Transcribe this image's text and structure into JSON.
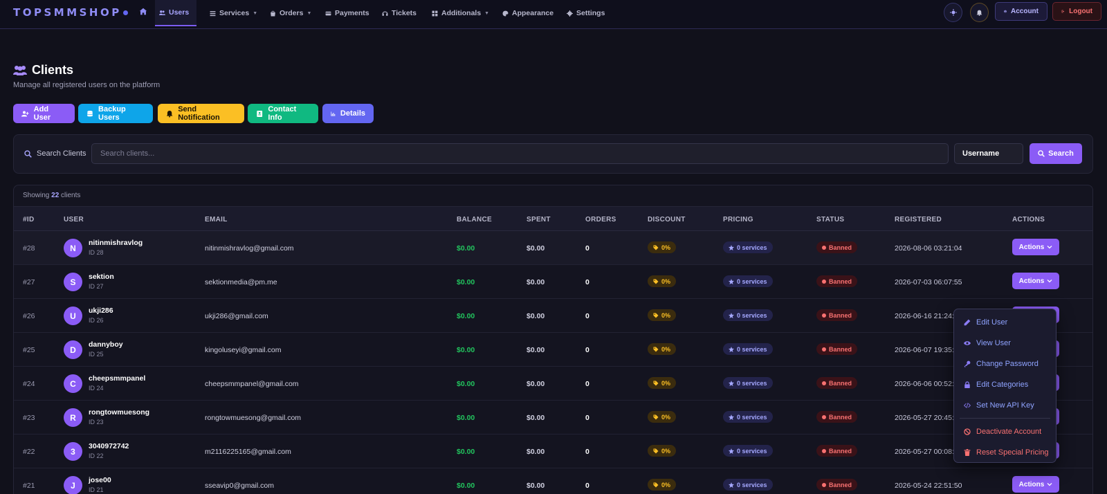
{
  "app": {
    "brand": "TOPSMMSHOP",
    "colors": {
      "accent": "#8b5cf6",
      "success": "#22c55e",
      "danger": "#f87171",
      "warning": "#fbbf24"
    }
  },
  "nav": {
    "items": [
      {
        "label": "Users",
        "icon": "users-icon",
        "active": true
      },
      {
        "label": "Services",
        "icon": "list-icon",
        "has_caret": true
      },
      {
        "label": "Orders",
        "icon": "bag-icon",
        "has_caret": true
      },
      {
        "label": "Payments",
        "icon": "card-icon"
      },
      {
        "label": "Tickets",
        "icon": "headset-icon"
      },
      {
        "label": "Additionals",
        "icon": "grid-icon",
        "has_caret": true
      },
      {
        "label": "Appearance",
        "icon": "palette-icon"
      },
      {
        "label": "Settings",
        "icon": "gear-icon"
      }
    ],
    "account_label": "Account",
    "logout_label": "Logout"
  },
  "page": {
    "title": "Clients",
    "subtitle": "Manage all registered users on the platform",
    "actions": [
      "Add User",
      "Backup Users",
      "Send Notification",
      "Contact Info",
      "Details"
    ]
  },
  "search": {
    "label": "Search Clients",
    "placeholder": "Search clients...",
    "value": "",
    "filter": "Username",
    "button": "Search"
  },
  "table": {
    "showing_prefix": "Showing",
    "showing_count": "22",
    "showing_suffix": "clients",
    "headers": [
      "#ID",
      "USER",
      "EMAIL",
      "BALANCE",
      "SPENT",
      "ORDERS",
      "DISCOUNT",
      "PRICING",
      "STATUS",
      "REGISTERED",
      "ACTIONS"
    ],
    "rows": [
      {
        "id": "#28",
        "initial": "N",
        "username": "nitinmishravlog",
        "uid": "ID 28",
        "email": "nitinmishravlog@gmail.com",
        "balance": "$0.00",
        "spent": "$0.00",
        "orders": "0",
        "discount": "0%",
        "pricing": "0 services",
        "status": "Banned",
        "registered": "2026-08-06 03:21:04",
        "action": "Actions"
      },
      {
        "id": "#27",
        "initial": "S",
        "username": "sektion",
        "uid": "ID 27",
        "email": "sektionmedia@pm.me",
        "balance": "$0.00",
        "spent": "$0.00",
        "orders": "0",
        "discount": "0%",
        "pricing": "0 services",
        "status": "Banned",
        "registered": "2026-07-03 06:07:55",
        "action": "Actions"
      },
      {
        "id": "#26",
        "initial": "U",
        "username": "ukji286",
        "uid": "ID 26",
        "email": "ukji286@gmail.com",
        "balance": "$0.00",
        "spent": "$0.00",
        "orders": "0",
        "discount": "0%",
        "pricing": "0 services",
        "status": "Banned",
        "registered": "2026-06-16 21:24:0",
        "action": ""
      },
      {
        "id": "#25",
        "initial": "D",
        "username": "dannyboy",
        "uid": "ID 25",
        "email": "kingoluseyi@gmail.com",
        "balance": "$0.00",
        "spent": "$0.00",
        "orders": "0",
        "discount": "0%",
        "pricing": "0 services",
        "status": "Banned",
        "registered": "2026-06-07 19:35:4",
        "action": ""
      },
      {
        "id": "#24",
        "initial": "C",
        "username": "cheepsmmpanel",
        "uid": "ID 24",
        "email": "cheepsmmpanel@gmail.com",
        "balance": "$0.00",
        "spent": "$0.00",
        "orders": "0",
        "discount": "0%",
        "pricing": "0 services",
        "status": "Banned",
        "registered": "2026-06-06 00:52:",
        "action": ""
      },
      {
        "id": "#23",
        "initial": "R",
        "username": "rongtowmuesong",
        "uid": "ID 23",
        "email": "rongtowmuesong@gmail.com",
        "balance": "$0.00",
        "spent": "$0.00",
        "orders": "0",
        "discount": "0%",
        "pricing": "0 services",
        "status": "Banned",
        "registered": "2026-05-27 20:45:",
        "action": ""
      },
      {
        "id": "#22",
        "initial": "3",
        "username": "3040972742",
        "uid": "ID 22",
        "email": "m2116225165@gmail.com",
        "balance": "$0.00",
        "spent": "$0.00",
        "orders": "0",
        "discount": "0%",
        "pricing": "0 services",
        "status": "Banned",
        "registered": "2026-05-27 00:08:",
        "action": ""
      },
      {
        "id": "#21",
        "initial": "J",
        "username": "jose00",
        "uid": "ID 21",
        "email": "sseavip0@gmail.com",
        "balance": "$0.00",
        "spent": "$0.00",
        "orders": "0",
        "discount": "0%",
        "pricing": "0 services",
        "status": "Banned",
        "registered": "2026-05-24 22:51:50",
        "action": "Actions"
      }
    ]
  },
  "dropdown": {
    "items": [
      {
        "label": "Edit User",
        "icon": "pencil-icon"
      },
      {
        "label": "View User",
        "icon": "eye-icon"
      },
      {
        "label": "Change Password",
        "icon": "key-icon"
      },
      {
        "label": "Edit Categories",
        "icon": "lock-icon"
      },
      {
        "label": "Set New API Key",
        "icon": "code-icon"
      },
      {
        "label": "Deactivate Account",
        "icon": "ban-icon",
        "danger": true
      },
      {
        "label": "Reset Special Pricing",
        "icon": "trash-icon",
        "danger": true
      }
    ]
  }
}
